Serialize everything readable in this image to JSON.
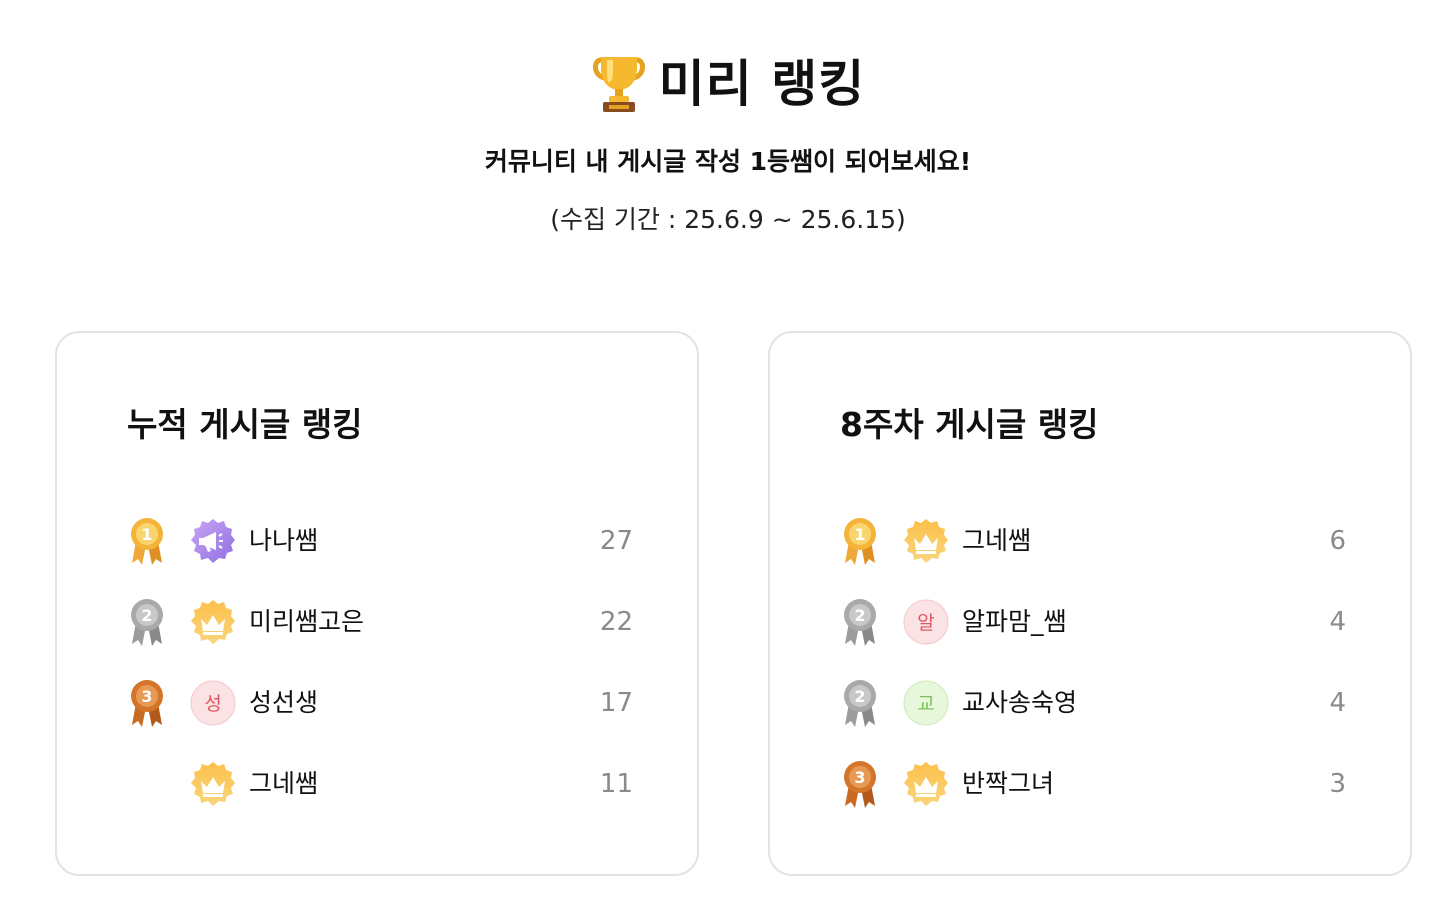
{
  "header": {
    "title": "미리 랭킹",
    "subtitle": "커뮤니티 내 게시글 작성 1등쌤이 되어보세요!",
    "period": "(수집 기간 : 25.6.9 ~ 25.6.15)"
  },
  "cumulative": {
    "title": "누적 게시글 랭킹",
    "rows": [
      {
        "medal": "1",
        "avatar": "megaphone-badge",
        "name": "나나쌤",
        "count": "27"
      },
      {
        "medal": "2",
        "avatar": "crown-badge",
        "name": "미리쌤고은",
        "count": "22"
      },
      {
        "medal": "3",
        "avatar": "letter",
        "avatar_text": "성",
        "name": "성선생",
        "count": "17"
      },
      {
        "medal": "",
        "avatar": "crown-badge",
        "name": "그네쌤",
        "count": "11"
      }
    ]
  },
  "weekly": {
    "title": "8주차 게시글 랭킹",
    "rows": [
      {
        "medal": "1",
        "avatar": "crown-badge",
        "name": "그네쌤",
        "count": "6"
      },
      {
        "medal": "2",
        "avatar": "letter",
        "avatar_text": "알",
        "name": "알파맘_쌤",
        "count": "4"
      },
      {
        "medal": "2",
        "avatar": "letter",
        "avatar_text": "교",
        "name": "교사송숙영",
        "count": "4"
      },
      {
        "medal": "3",
        "avatar": "crown-badge",
        "name": "반짝그녀",
        "count": "3"
      }
    ]
  },
  "colors": {
    "gold": "#F4B43A",
    "silver": "#A9A9A9",
    "bronze": "#D4752A",
    "count_text": "#8A8A8A",
    "card_border": "#E3E3E3",
    "letter_pink_bg": "#FBE2E4",
    "letter_pink_fg": "#E0575F",
    "letter_green_bg": "#E6F7DC",
    "letter_green_fg": "#7CC25A"
  }
}
